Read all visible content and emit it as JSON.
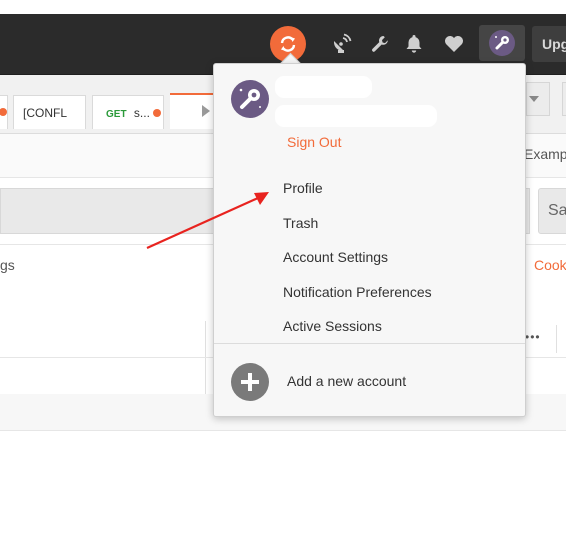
{
  "header": {
    "upgrade_label": "Upg",
    "icons": [
      "sync-icon",
      "satellite-icon",
      "wrench-icon",
      "bell-icon",
      "heart-icon",
      "avatar-icon"
    ],
    "accent_color": "#f26b3a"
  },
  "tabs": [
    {
      "label": "[CONFL"
    },
    {
      "method": "GET",
      "label": "s...",
      "unsaved": true
    }
  ],
  "workspace": {
    "examples_label": "Examp",
    "save_label": "Sa",
    "settings_label": "gs",
    "cookies_label": "Cook",
    "more_label": "•••"
  },
  "account_menu": {
    "sign_out": "Sign Out",
    "items": [
      "Profile",
      "Trash",
      "Account Settings",
      "Notification Preferences",
      "Active Sessions"
    ],
    "add_account": "Add a new account"
  },
  "annotation": {
    "color": "#e8231f"
  }
}
